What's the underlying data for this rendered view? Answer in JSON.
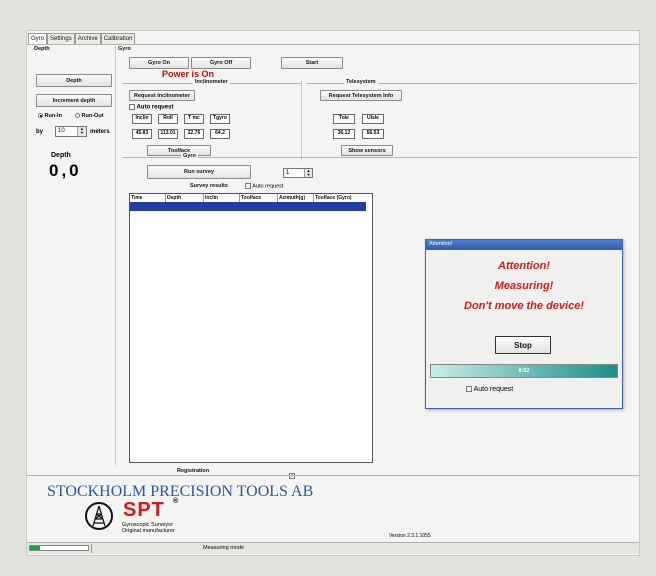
{
  "tabs": [
    "Gyro",
    "Settings",
    "Archive",
    "Calibration"
  ],
  "depth_panel": {
    "group_label": "Depth",
    "depth_button": "Depth",
    "increment_button": "Increment depth",
    "run_in": "Run-In",
    "run_out": "Run-Out",
    "by_label": "by",
    "by_value": "10",
    "meters_label": "meters",
    "depth_title": "Depth",
    "depth_value": "0,0"
  },
  "gyro_panel": {
    "group_label": "Gyro",
    "gyro_on": "Gyro On",
    "gyro_off": "Gyro Off",
    "start": "Start",
    "power_status": "Power is On",
    "status_color": "#b01010"
  },
  "inclinometer": {
    "group_label": "Inclinometer",
    "request_button": "Request Inclinometer",
    "auto_request": "Auto request",
    "headers": [
      "Inclin",
      "Roll",
      "T mc",
      "Tgyro"
    ],
    "values": [
      "45.83",
      "113.01",
      "22.76",
      "64.2"
    ],
    "toolface_button": "Toolface"
  },
  "telesystem": {
    "group_label": "Telesystem",
    "request_button": "Request Telesystem Info",
    "headers": [
      "Tole",
      "Ulsle"
    ],
    "values": [
      "36.12",
      "56.53"
    ],
    "show_sensors": "Show sensors"
  },
  "survey": {
    "group_label": "Gyro",
    "run_survey": "Run survey",
    "spinner_value": "1",
    "results_label": "Survey results",
    "auto_request": "Auto request",
    "columns": [
      "Time",
      "Depth",
      "Inclin",
      "Toolface",
      "Azimuth(g)",
      "Toolface (Gyro)"
    ],
    "registration": "Registration"
  },
  "dialog": {
    "title": "Attention!",
    "line1": "Attention!",
    "line2": "Measuring!",
    "line3": "Don't move the device!",
    "stop_button": "Stop",
    "timer": "8:52",
    "auto_request": "Auto request",
    "text_color": "#d41a1a",
    "progress_color": "#1b8e8a"
  },
  "footer": {
    "company": "STOCKHOLM PRECISION TOOLS AB",
    "logo_text": "SPT",
    "registered": "®",
    "tagline1": "Gyroscopic Surveyor",
    "tagline2": "Original manufacturer",
    "version": "Version 2.3.1.1055"
  },
  "status_bar": {
    "text": "Measuring mode",
    "progress_fraction": 0.17,
    "progress_color": "#1fa33a"
  }
}
